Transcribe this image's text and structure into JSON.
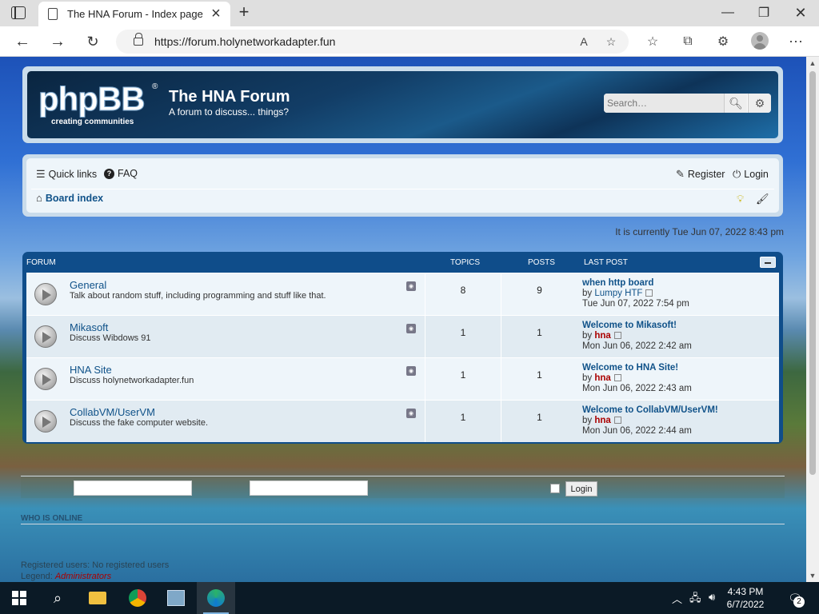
{
  "browser": {
    "tab_title": "The HNA Forum - Index page",
    "url": "https://forum.holynetworkadapter.fun"
  },
  "header": {
    "logo_text": "phpBB",
    "logo_tagline": "creating communities",
    "site_title": "The HNA Forum",
    "site_description": "A forum to discuss... things?",
    "search_placeholder": "Search…"
  },
  "navbar": {
    "quick_links": "Quick links",
    "faq": "FAQ",
    "register": "Register",
    "login": "Login",
    "breadcrumb": "Board index"
  },
  "current_time": "It is currently Tue Jun 07, 2022 8:43 pm",
  "forum_table": {
    "headers": {
      "forum": "Forum",
      "topics": "Topics",
      "posts": "Posts",
      "last_post": "Last post"
    },
    "rows": [
      {
        "name": "General",
        "description": "Talk about random stuff, including programming and stuff like that.",
        "topics": "8",
        "posts": "9",
        "last_title": "when http board",
        "last_author": "Lumpy HTF",
        "last_time": "Tue Jun 07, 2022 7:54 pm"
      },
      {
        "name": "Mikasoft",
        "description": "Discuss Wibdows 91",
        "topics": "1",
        "posts": "1",
        "last_title": "Welcome to Mikasoft!",
        "last_author": "hna",
        "last_time": "Mon Jun 06, 2022 2:42 am"
      },
      {
        "name": "HNA Site",
        "description": "Discuss holynetworkadapter.fun",
        "topics": "1",
        "posts": "1",
        "last_title": "Welcome to HNA Site!",
        "last_author": "hna",
        "last_time": "Mon Jun 06, 2022 2:43 am"
      },
      {
        "name": "CollabVM/UserVM",
        "description": "Discuss the fake computer website.",
        "topics": "1",
        "posts": "1",
        "last_title": "Welcome to CollabVM/UserVM!",
        "last_author": "hna",
        "last_time": "Mon Jun 06, 2022 2:44 am"
      }
    ],
    "by_label": "by"
  },
  "login_strip": {
    "button": "Login"
  },
  "whos_online": {
    "title": "Who is online",
    "registered_users": "Registered users: No registered users",
    "legend_prefix": "Legend:",
    "legend_admins": "Administrators"
  },
  "taskbar": {
    "time": "4:43 PM",
    "date": "6/7/2022",
    "notifications": "2"
  },
  "colors": {
    "link": "#105289",
    "admin": "#aa0000",
    "table_head": "#0f4d8a"
  }
}
